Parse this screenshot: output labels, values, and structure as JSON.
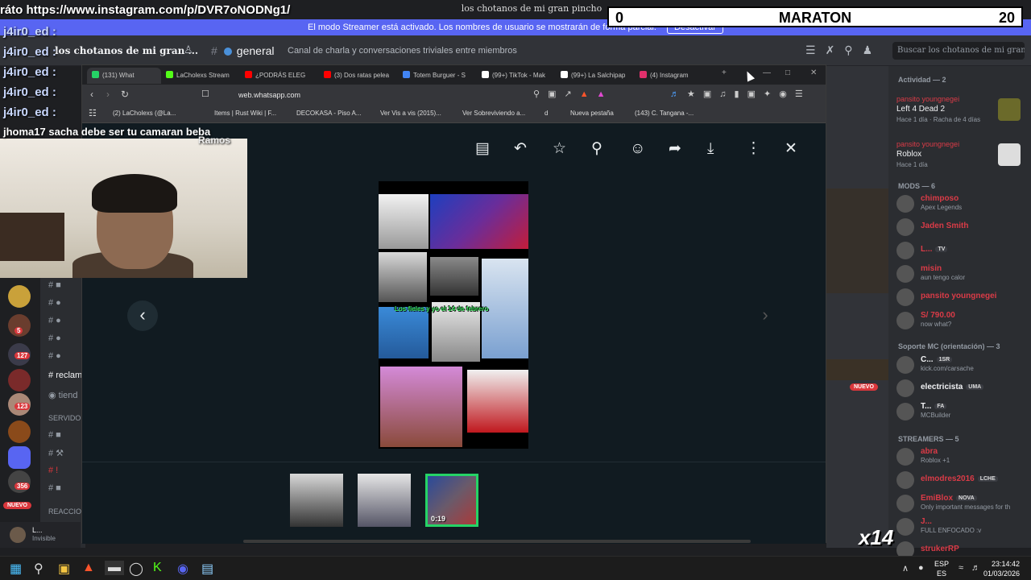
{
  "overlay": {
    "url_text": "ráto https://www.instagram.com/p/DVR7oNODNg1/",
    "scoreboard": {
      "left": "0",
      "title": "MARATON",
      "right": "20"
    },
    "chat_names": [
      "j4ir0_ed :",
      "j4ir0_ed :",
      "j4ir0_ed :",
      "j4ir0_ed :",
      "j4ir0_ed :"
    ],
    "chat_line": "jhoma17 sacha debe ser tu camaran beba",
    "sub_text": "Ramos",
    "counter": "x14"
  },
  "discord": {
    "window_title": "los chotanos de mi gran pincho",
    "streamer_banner": {
      "text": "El modo Streamer está activado. Los nombres de usuario se mostrarán de forma parcial.",
      "button": "Desactivar"
    },
    "server_name": "los chotanos de mi gran ...",
    "channel_name": "general",
    "channel_topic": "Canal de charla y conversaciones triviales entre miembros",
    "search_placeholder": "Buscar los chotanos de mi gran pi...",
    "header_icons": [
      "threads-icon",
      "mute-icon",
      "pin-icon",
      "members-icon"
    ],
    "channels": [
      {
        "label": "reclam"
      },
      {
        "label": "tiend"
      }
    ],
    "section_servidor": "SERVIDOR",
    "section_reaccion": "REACCION",
    "rail_badges": [
      "5",
      "127",
      "123",
      "356"
    ],
    "new_pill": "NUEVO",
    "nuevo_side": "NUEVO",
    "user": {
      "name": "L...",
      "status": "Invisible"
    },
    "activity": {
      "header": "Actividad — 2",
      "items": [
        {
          "user": "pansito youngnegei",
          "game": "Left 4 Dead 2",
          "time": "Hace 1 día  ·  Racha de 4 días"
        },
        {
          "user": "pansito youngnegei",
          "game": "Roblox",
          "time": "Hace 1 día"
        }
      ]
    },
    "members": {
      "mods_header": "MODS — 6",
      "mods": [
        {
          "name": "chimposo",
          "status": "Apex Legends",
          "color": "#da3b47"
        },
        {
          "name": "Jaden Smith",
          "status": "",
          "color": "#da3b47"
        },
        {
          "name": "L...",
          "status": "",
          "color": "#da3b47",
          "tag": "TV"
        },
        {
          "name": "misin",
          "status": "aun tengo calor",
          "color": "#da3b47"
        },
        {
          "name": "pansito youngnegei",
          "status": "",
          "color": "#da3b47"
        },
        {
          "name": "S/ 790.00",
          "status": "now what?",
          "color": "#da3b47"
        }
      ],
      "soporte_header": "Soporte MC (orientación) — 3",
      "soporte": [
        {
          "name": "C...",
          "status": "kick.com/carsache",
          "color": "#f2f3f5",
          "tag": "1SR"
        },
        {
          "name": "electricista",
          "status": "",
          "color": "#f2f3f5",
          "tag": "UMA"
        },
        {
          "name": "T...",
          "status": "MCBuilder",
          "color": "#f2f3f5",
          "tag": "FA"
        }
      ],
      "streamers_header": "STREAMERS — 5",
      "streamers": [
        {
          "name": "abra",
          "status": "Roblox +1",
          "color": "#da3b47"
        },
        {
          "name": "elmodres2016",
          "status": "",
          "color": "#da3b47",
          "tag": "LCHE"
        },
        {
          "name": "EmiBlox",
          "status": "Only important messages for th",
          "color": "#da3b47",
          "tag": "NOVA"
        },
        {
          "name": "J...",
          "status": "FULL ENFOCADO :v",
          "color": "#da3b47"
        },
        {
          "name": "strukerRP",
          "status": "",
          "color": "#da3b47"
        }
      ]
    }
  },
  "browser": {
    "tabs": [
      {
        "label": "(131) What",
        "color": "#25d366"
      },
      {
        "label": "LaCholexs Stream",
        "color": "#53fc18"
      },
      {
        "label": "¿PODRÁS ELEG",
        "color": "#ff0000"
      },
      {
        "label": "(3) Dos ratas pelea",
        "color": "#ff0000"
      },
      {
        "label": "Totem Burguer - S",
        "color": "#4285f4"
      },
      {
        "label": "(99+) TikTok - Mak",
        "color": "#ffffff"
      },
      {
        "label": "(99+) La Salchipap",
        "color": "#ffffff"
      },
      {
        "label": "(4) Instagram",
        "color": "#e1306c"
      }
    ],
    "url": "web.whatsapp.com",
    "bookmarks": [
      "(2) LaCholexs (@La...",
      "Items | Rust Wiki | F...",
      "DECOKASA - Piso A...",
      "Ver Vis a vis (2015)...",
      "Ver Sobreviviendo a...",
      "d",
      "Nueva pestaña",
      "(143) C. Tangana -..."
    ]
  },
  "viewer": {
    "toolbar_icons": [
      "message-icon",
      "reply-icon",
      "star-icon",
      "pin-icon",
      "emoji-icon",
      "forward-icon",
      "download-icon",
      "more-icon",
      "close-icon"
    ],
    "collage_caption": "Los fieles y yo el 14 de febrero",
    "thumb_duration": "0:19"
  },
  "taskbar": {
    "lang_top": "ESP",
    "lang_bottom": "ES",
    "time": "23:14:42",
    "date": "01/03/2026"
  }
}
